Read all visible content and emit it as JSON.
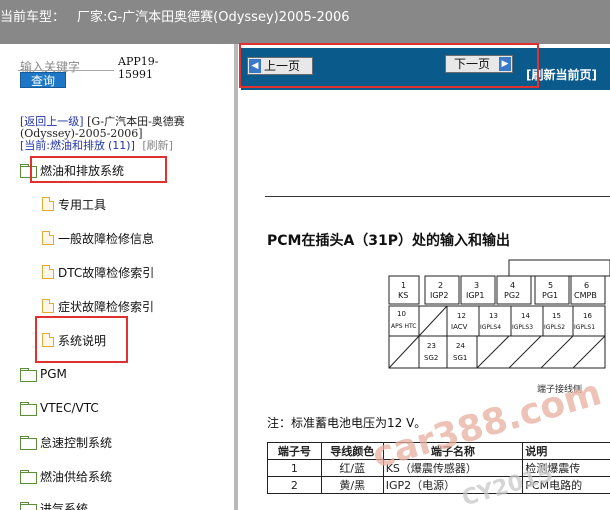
{
  "topbar": {
    "vehicle_label": "当前车型：",
    "vehicle_value": "厂家:G-广汽本田奥德赛(Odyssey)2005-2006",
    "dot": "."
  },
  "search": {
    "keyword_label": "输入关键字",
    "query_button": "查询",
    "app_code": "APP19-15991"
  },
  "nav": {
    "back_link": "[返回上一级]",
    "back_context": "[G-广汽本田-奥德赛(Odyssey)-2005-2006]",
    "current_prefix": "[当前:",
    "current_value": "燃油和排放",
    "current_count": "(11)",
    "current_suffix": "]",
    "refresh": "[刷新]"
  },
  "tree": {
    "root": "燃油和排放系统",
    "children": [
      "专用工具",
      "一般故障检修信息",
      "DTC故障检修索引",
      "症状故障检修索引",
      "系统说明"
    ],
    "siblings": [
      "PGM",
      "VTEC/VTC",
      "怠速控制系统",
      "燃油供给系统",
      "进气系统"
    ]
  },
  "toolbar": {
    "prev_page": "上一页",
    "next_page": "下一页",
    "refresh_current": "[刷新当前页]"
  },
  "doc": {
    "title": "PCM在插头A（31P）处的输入和输出",
    "connector_rows": [
      [
        {
          "n": "1",
          "s": "KS"
        },
        {
          "n": "2",
          "s": "IGP2"
        },
        {
          "n": "3",
          "s": "IGP1"
        },
        {
          "n": "4",
          "s": "PG2"
        },
        {
          "n": "5",
          "s": "PG1"
        },
        {
          "n": "6",
          "s": "CMPB"
        }
      ],
      [
        {
          "n": "10",
          "s": "APS HTC"
        },
        {
          "n": "",
          "s": ""
        },
        {
          "n": "12",
          "s": "IACV"
        },
        {
          "n": "13",
          "s": "IGPLS4"
        },
        {
          "n": "14",
          "s": "IGPLS3"
        },
        {
          "n": "15",
          "s": "IGPLS2"
        },
        {
          "n": "16",
          "s": "IGPLS1"
        }
      ],
      [
        {
          "n": "23",
          "s": "SG2"
        },
        {
          "n": "24",
          "s": "SG1"
        }
      ]
    ],
    "harness_label": "端子接线侧",
    "note": "注：标准蓄电池电压为12 V。",
    "table_headers": [
      "端子号",
      "导线颜色",
      "端子名称",
      "说明"
    ],
    "table_rows": [
      [
        "1",
        "红/蓝",
        "KS（爆震传感器）",
        "检测爆震传"
      ],
      [
        "2",
        "黄/黑",
        "IGP2（电源）",
        "PCM电路的"
      ]
    ]
  },
  "watermark": {
    "brand": "car388.com",
    "copy": "CY2015"
  },
  "colors": {
    "topbar_bg": "#888888",
    "toolbar_bg": "#0a5a8c",
    "query_btn": "#1d77c6",
    "highlight_box": "#e03030",
    "link": "#2233aa"
  }
}
